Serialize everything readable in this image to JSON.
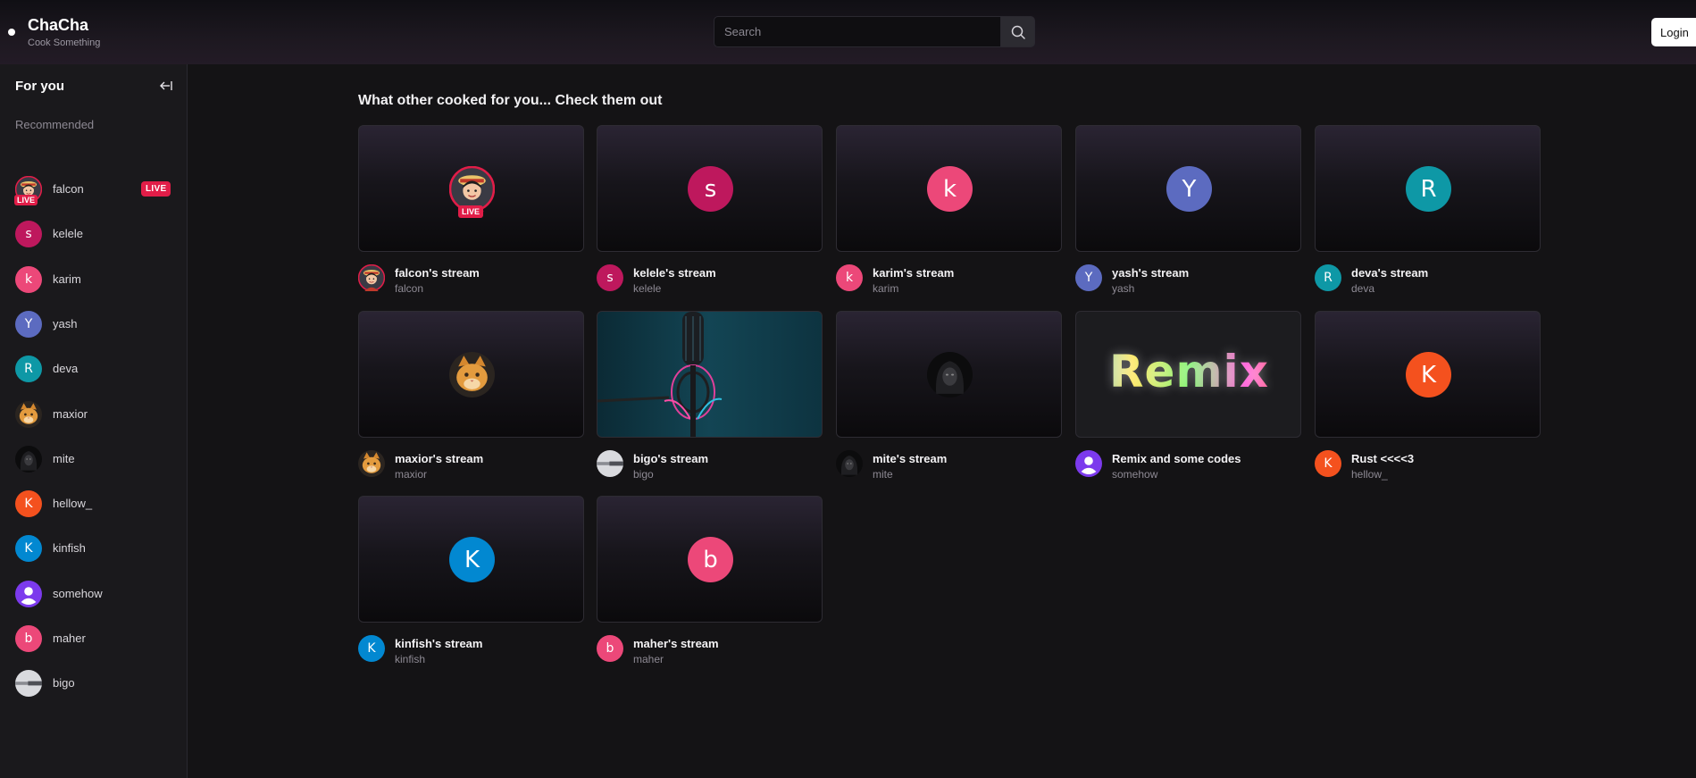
{
  "header": {
    "brand": "ChaCha",
    "tagline": "Cook Something",
    "search_placeholder": "Search",
    "login_label": "Login"
  },
  "sidebar": {
    "title": "For you",
    "section": "Recommended",
    "live_label": "LIVE",
    "items": [
      {
        "name": "falcon",
        "letter": "",
        "color": "",
        "live": true
      },
      {
        "name": "kelele",
        "letter": "s",
        "color": "#be185d",
        "live": false
      },
      {
        "name": "karim",
        "letter": "k",
        "color": "#ec4879",
        "live": false
      },
      {
        "name": "yash",
        "letter": "Y",
        "color": "#5c6bc0",
        "live": false
      },
      {
        "name": "deva",
        "letter": "R",
        "color": "#0e98a6",
        "live": false
      },
      {
        "name": "maxior",
        "letter": "",
        "color": "",
        "live": false
      },
      {
        "name": "mite",
        "letter": "",
        "color": "",
        "live": false
      },
      {
        "name": "hellow_",
        "letter": "K",
        "color": "#f4511e",
        "live": false
      },
      {
        "name": "kinfish",
        "letter": "K",
        "color": "#0288d1",
        "live": false
      },
      {
        "name": "somehow",
        "letter": "",
        "color": "#7c3aed",
        "live": false
      },
      {
        "name": "maher",
        "letter": "b",
        "color": "#ec4879",
        "live": false
      },
      {
        "name": "bigo",
        "letter": "",
        "color": "",
        "live": false
      }
    ]
  },
  "main": {
    "title": "What other cooked for you... Check them out",
    "live_label": "LIVE",
    "thumbnail_text": "Remix",
    "streams": [
      {
        "title": "falcon's stream",
        "user": "falcon"
      },
      {
        "title": "kelele's stream",
        "user": "kelele"
      },
      {
        "title": "karim's stream",
        "user": "karim"
      },
      {
        "title": "yash's stream",
        "user": "yash"
      },
      {
        "title": "deva's stream",
        "user": "deva"
      },
      {
        "title": "maxior's stream",
        "user": "maxior"
      },
      {
        "title": "bigo's stream",
        "user": "bigo"
      },
      {
        "title": "mite's stream",
        "user": "mite"
      },
      {
        "title": "Remix and some codes",
        "user": "somehow"
      },
      {
        "title": "Rust <<<<3",
        "user": "hellow_"
      },
      {
        "title": "kinfish's stream",
        "user": "kinfish"
      },
      {
        "title": "maher's stream",
        "user": "maher"
      }
    ]
  }
}
